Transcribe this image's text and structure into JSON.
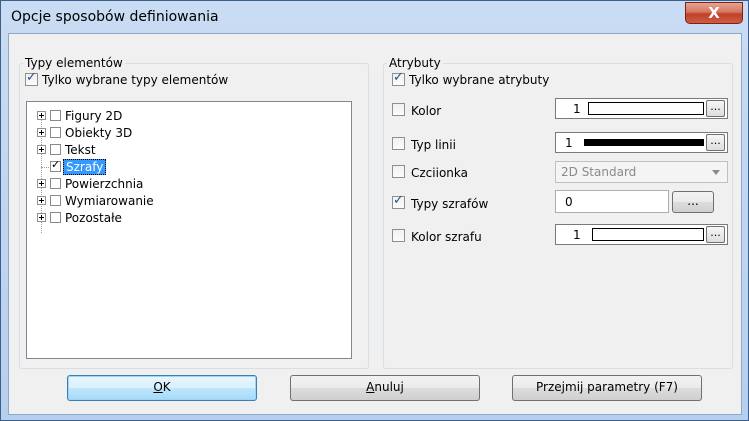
{
  "window": {
    "title": "Opcje sposobów definiowania",
    "close_glyph": "X"
  },
  "left_group": {
    "label": "Typy elementów",
    "only_selected_types": {
      "label": "Tylko wybrane typy elementów",
      "checked": true
    },
    "tree": [
      {
        "label": "Figury 2D",
        "expandable": true,
        "checked": false,
        "selected": false
      },
      {
        "label": "Obiekty 3D",
        "expandable": true,
        "checked": false,
        "selected": false
      },
      {
        "label": "Tekst",
        "expandable": true,
        "checked": false,
        "selected": false
      },
      {
        "label": "Szrafy",
        "expandable": false,
        "checked": true,
        "selected": true
      },
      {
        "label": "Powierzchnia",
        "expandable": true,
        "checked": false,
        "selected": false
      },
      {
        "label": "Wymiarowanie",
        "expandable": true,
        "checked": false,
        "selected": false
      },
      {
        "label": "Pozostałe",
        "expandable": true,
        "checked": false,
        "selected": false
      }
    ]
  },
  "right_group": {
    "label": "Atrybuty",
    "only_selected_attrs": {
      "label": "Tylko wybrane atrybuty",
      "checked": true
    },
    "kolor": {
      "label": "Kolor",
      "checked": false,
      "value": "1",
      "ellipsis": "..."
    },
    "typ_linii": {
      "label": "Typ linii",
      "checked": false,
      "value": "1",
      "ellipsis": "..."
    },
    "czcionka": {
      "label": "Czciionka",
      "checked": false,
      "value": "2D Standard"
    },
    "typy_szrafow": {
      "label": "Typy szrafów",
      "checked": true,
      "value": "0",
      "ellipsis": "..."
    },
    "kolor_szrafu": {
      "label": "Kolor szrafu",
      "checked": false,
      "value": "1",
      "ellipsis": "..."
    }
  },
  "buttons": {
    "ok_mnemonic": "O",
    "ok_rest": "K",
    "cancel_mnemonic": "A",
    "cancel_rest": "nuluj",
    "take_params": "Przejmij parametry (F7)"
  }
}
